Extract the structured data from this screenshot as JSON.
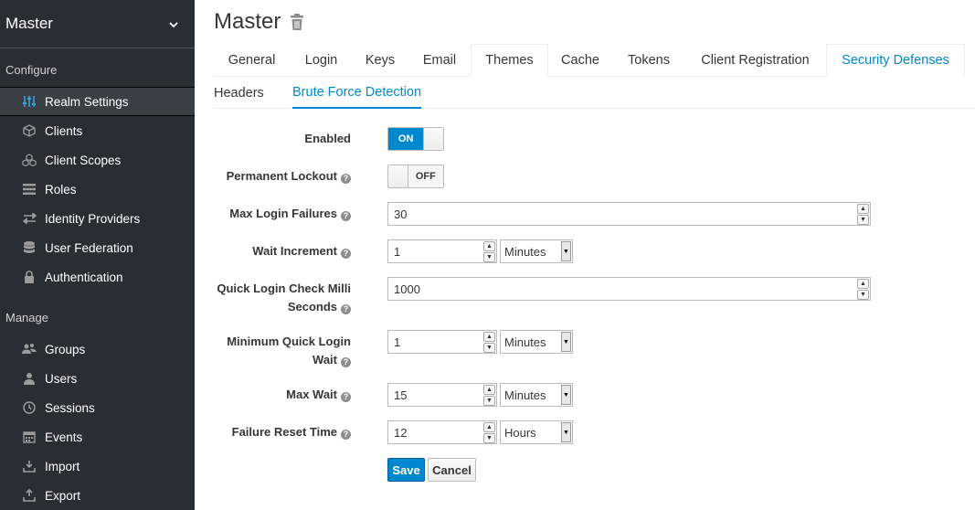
{
  "sidebar": {
    "realm": "Master",
    "configure_label": "Configure",
    "manage_label": "Manage",
    "configure_items": [
      {
        "label": "Realm Settings",
        "icon": "sliders-icon"
      },
      {
        "label": "Clients",
        "icon": "cube-icon"
      },
      {
        "label": "Client Scopes",
        "icon": "cubes-icon"
      },
      {
        "label": "Roles",
        "icon": "list-icon"
      },
      {
        "label": "Identity Providers",
        "icon": "exchange-icon"
      },
      {
        "label": "User Federation",
        "icon": "database-icon"
      },
      {
        "label": "Authentication",
        "icon": "lock-icon"
      }
    ],
    "manage_items": [
      {
        "label": "Groups",
        "icon": "users-icon"
      },
      {
        "label": "Users",
        "icon": "user-icon"
      },
      {
        "label": "Sessions",
        "icon": "clock-icon"
      },
      {
        "label": "Events",
        "icon": "calendar-icon"
      },
      {
        "label": "Import",
        "icon": "import-icon"
      },
      {
        "label": "Export",
        "icon": "export-icon"
      }
    ]
  },
  "header": {
    "title": "Master"
  },
  "tabs": [
    "General",
    "Login",
    "Keys",
    "Email",
    "Themes",
    "Cache",
    "Tokens",
    "Client Registration",
    "Security Defenses"
  ],
  "subtabs": [
    "Headers",
    "Brute Force Detection"
  ],
  "form": {
    "enabled_label": "Enabled",
    "enabled_state": "ON",
    "permanent_lockout_label": "Permanent Lockout",
    "permanent_lockout_state": "OFF",
    "max_login_failures_label": "Max Login Failures",
    "max_login_failures_value": "30",
    "wait_increment_label": "Wait Increment",
    "wait_increment_value": "1",
    "wait_increment_unit": "Minutes",
    "quick_login_label_1": "Quick Login Check Milli",
    "quick_login_label_2": "Seconds",
    "quick_login_value": "1000",
    "min_quick_wait_label_1": "Minimum Quick Login",
    "min_quick_wait_label_2": "Wait",
    "min_quick_wait_value": "1",
    "min_quick_wait_unit": "Minutes",
    "max_wait_label": "Max Wait",
    "max_wait_value": "15",
    "max_wait_unit": "Minutes",
    "failure_reset_label": "Failure Reset Time",
    "failure_reset_value": "12",
    "failure_reset_unit": "Hours",
    "save_label": "Save",
    "cancel_label": "Cancel"
  },
  "colors": {
    "accent": "#0088ce",
    "sidebar_bg": "#292e34"
  }
}
